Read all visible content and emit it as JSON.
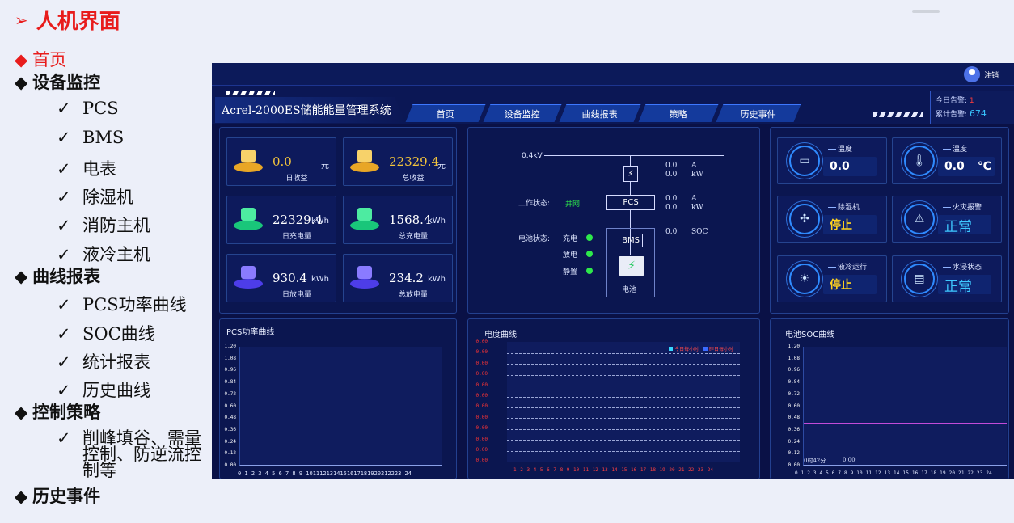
{
  "slide": {
    "title": "人机界面",
    "outline": [
      {
        "level": 1,
        "text": "首页",
        "active": true
      },
      {
        "level": 1,
        "text": "设备监控"
      },
      {
        "level": 2,
        "text": "PCS"
      },
      {
        "level": 2,
        "text": "BMS"
      },
      {
        "level": 2,
        "text": "电表"
      },
      {
        "level": 2,
        "text": "除湿机"
      },
      {
        "level": 2,
        "text": "消防主机"
      },
      {
        "level": 2,
        "text": "液冷主机"
      },
      {
        "level": 1,
        "text": "曲线报表"
      },
      {
        "level": 2,
        "text": "PCS功率曲线"
      },
      {
        "level": 2,
        "text": "SOC曲线"
      },
      {
        "level": 2,
        "text": "统计报表"
      },
      {
        "level": 2,
        "text": "历史曲线"
      },
      {
        "level": 1,
        "text": "控制策略"
      },
      {
        "level": 2,
        "text": "削峰填谷、需量控制、防逆流控制等"
      },
      {
        "level": 1,
        "text": "历史事件"
      }
    ]
  },
  "app": {
    "title": "Acrel-2000ES储能能量管理系统",
    "user": {
      "label": "注销"
    },
    "nav": [
      "首页",
      "设备监控",
      "曲线报表",
      "策略",
      "历史事件"
    ],
    "alarm": {
      "today_label": "今日告警:",
      "today_value": "1",
      "total_label": "累计告警:",
      "total_value": "674"
    },
    "stats": [
      {
        "value": "0.0",
        "unit": "元",
        "label": "日收益",
        "icon": "gold-coin-icon"
      },
      {
        "value": "22329.4",
        "unit": "元",
        "label": "总收益",
        "icon": "gold-coin-icon"
      },
      {
        "value": "22329.4",
        "unit": "kWh",
        "label": "日充电量",
        "icon": "battery-charge-icon"
      },
      {
        "value": "1568.4",
        "unit": "kWh",
        "label": "总充电量",
        "icon": "battery-charge-icon"
      },
      {
        "value": "930.4",
        "unit": "kWh",
        "label": "日放电量",
        "icon": "battery-discharge-icon"
      },
      {
        "value": "234.2",
        "unit": "kWh",
        "label": "总放电量",
        "icon": "battery-discharge-icon"
      }
    ],
    "diagram": {
      "bus": "0.4kV",
      "meter": {
        "a": "0.0",
        "a_unit": "A",
        "kw": "0.0",
        "kw_unit": "kW"
      },
      "pcs": {
        "label": "PCS",
        "a": "0.0",
        "a_unit": "A",
        "kw": "0.0",
        "kw_unit": "kW"
      },
      "work_label": "工作状态:",
      "work_value": "并网",
      "battery_label": "电池状态:",
      "states": [
        "充电",
        "放电",
        "静置"
      ],
      "bms": {
        "label": "BMS",
        "soc": "0.0",
        "soc_unit": "SOC"
      },
      "battery_caption": "电池"
    },
    "env": [
      {
        "label": "温度",
        "value": "0.0",
        "icon": "air-conditioner-icon"
      },
      {
        "label": "温度",
        "value": "0.0",
        "unit": "℃",
        "icon": "thermometer-icon"
      },
      {
        "label": "除湿机",
        "value": "停止",
        "icon": "fan-icon"
      },
      {
        "label": "火灾报警",
        "value": "正常",
        "icon": "fire-alarm-icon"
      },
      {
        "label": "液冷运行",
        "value": "停止",
        "icon": "lightbulb-icon"
      },
      {
        "label": "水浸状态",
        "value": "正常",
        "icon": "water-sensor-icon"
      }
    ],
    "env_colors": {
      "running": "#ffd21f",
      "normal": "#3ec8ff"
    },
    "charts": {
      "pcs": {
        "title": "PCS功率曲线",
        "y": [
          "1.20",
          "1.08",
          "0.96",
          "0.84",
          "0.72",
          "0.60",
          "0.48",
          "0.36",
          "0.24",
          "0.12",
          "0.00"
        ],
        "x": "0 1 2 3 4 5 6 7 8 9 1011121314151617181920212223 24"
      },
      "energy": {
        "title": "电度曲线",
        "y": [
          "0.00",
          "0.00",
          "0.00",
          "0.00",
          "0.00",
          "0.00",
          "0.00",
          "0.00",
          "0.00",
          "0.00",
          "0.00",
          "0.00"
        ],
        "legend": [
          "今日每小时",
          "昨日每小时"
        ],
        "x": "1 2 3 4 5 6 7 8 9 10 11 12 13 14 15 16 17 18 19 20 21 22 23 24"
      },
      "soc": {
        "title": "电池SOC曲线",
        "y": [
          "1.20",
          "1.08",
          "0.96",
          "0.84",
          "0.72",
          "0.60",
          "0.48",
          "0.36",
          "0.24",
          "0.12",
          "0.00"
        ],
        "x": "0 1 2 3 4 5 6 7 8 9 10 11 12 13 14 15 16 17 18 19 20 21 22 23 24",
        "tooltip_time": "0时42分",
        "tooltip_value": "0.00"
      }
    }
  }
}
